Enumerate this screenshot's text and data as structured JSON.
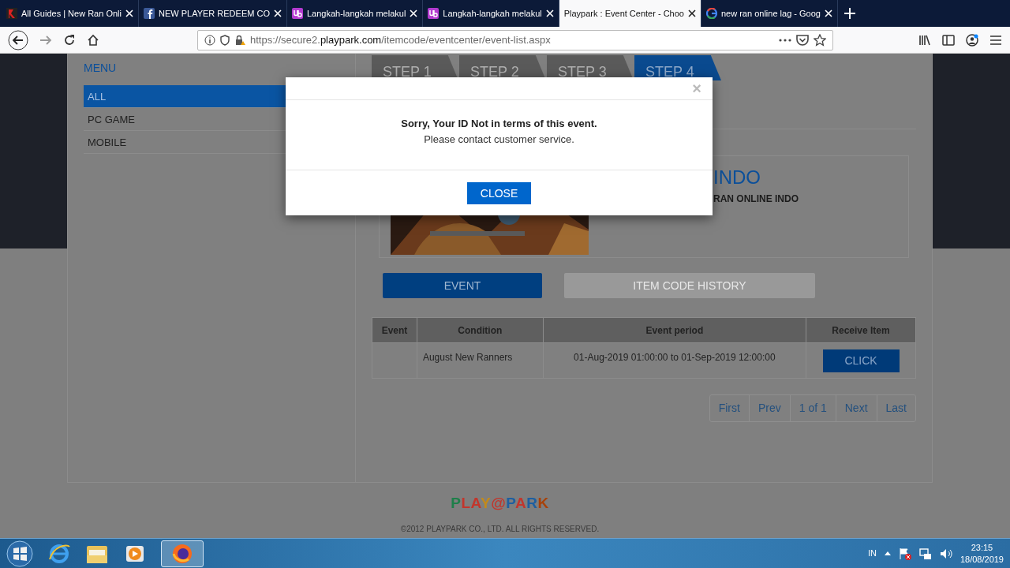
{
  "browser": {
    "tabs": [
      {
        "title": "All Guides | New Ran Onli",
        "selected": false
      },
      {
        "title": "NEW PLAYER REDEEM CO",
        "selected": false
      },
      {
        "title": "Langkah-langkah melakul",
        "selected": false
      },
      {
        "title": "Langkah-langkah melakul",
        "selected": false
      },
      {
        "title": "Playpark : Event Center - Choo",
        "selected": true
      },
      {
        "title": "new ran online lag - Goog",
        "selected": false
      }
    ],
    "url": {
      "prefix": "https://secure2.",
      "domain": "playpark.com",
      "path": "/itemcode/eventcenter/event-list.aspx"
    }
  },
  "page": {
    "menu": {
      "title": "MENU",
      "items": [
        {
          "label": "ALL",
          "selected": true
        },
        {
          "label": "PC GAME",
          "selected": false
        },
        {
          "label": "MOBILE",
          "selected": false
        }
      ]
    },
    "steps": [
      {
        "label": "STEP 1",
        "selected": false
      },
      {
        "label": "STEP 2",
        "selected": false
      },
      {
        "label": "STEP 3",
        "selected": false
      },
      {
        "label": "STEP 4",
        "selected": true
      }
    ],
    "event": {
      "title": "INDO",
      "subtitle": "RAN ONLINE INDO"
    },
    "tabs": [
      {
        "label": "EVENT",
        "selected": true
      },
      {
        "label": "ITEM CODE HISTORY",
        "selected": false
      }
    ],
    "table": {
      "columns": [
        "Event",
        "Condition",
        "Event period",
        "Receive Item"
      ],
      "rows": [
        {
          "condition": "August New Ranners",
          "period": "01-Aug-2019 01:00:00 to 01-Sep-2019 12:00:00",
          "action": "CLICK"
        }
      ]
    },
    "pagination": [
      "First",
      "Prev",
      "1 of 1",
      "Next",
      "Last"
    ],
    "footer": {
      "logo": "PLAY@PARK",
      "copyright": "©2012 PLAYPARK CO., LTD. ALL RIGHTS RESERVED."
    }
  },
  "dialog": {
    "close": "×",
    "message": "Sorry, Your ID Not in terms of this event.",
    "detail": "Please contact customer service.",
    "button": "CLOSE"
  },
  "taskbar": {
    "language": "IN",
    "time": "23:15",
    "date": "18/08/2019"
  }
}
